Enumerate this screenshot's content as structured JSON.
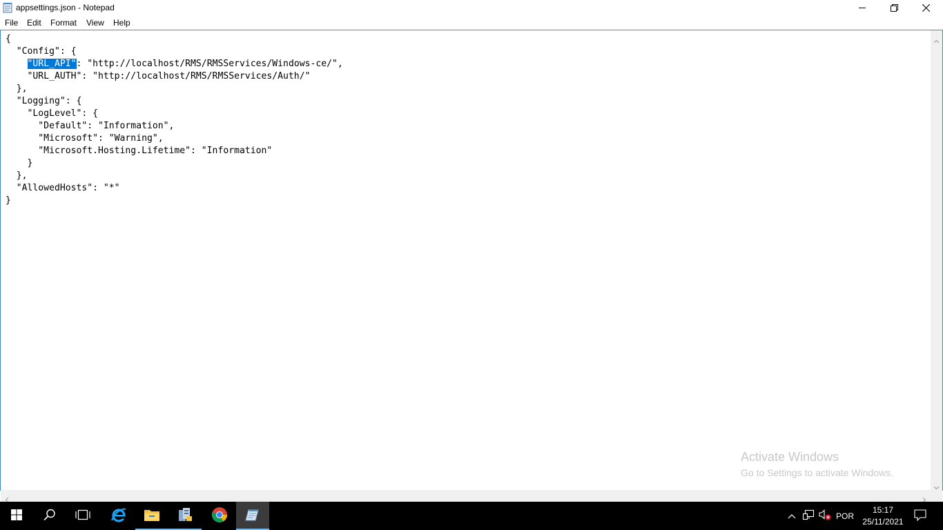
{
  "window": {
    "title": "appsettings.json - Notepad"
  },
  "menu": [
    "File",
    "Edit",
    "Format",
    "View",
    "Help"
  ],
  "editor": {
    "before_selection": "{\n  \"Config\": {\n    ",
    "selected": "\"URL_API\"",
    "after_selection": ": \"http://localhost/RMS/RMSServices/Windows-ce/\",\n    \"URL_AUTH\": \"http://localhost/RMS/RMSServices/Auth/\"\n  },\n  \"Logging\": {\n    \"LogLevel\": {\n      \"Default\": \"Information\",\n      \"Microsoft\": \"Warning\",\n      \"Microsoft.Hosting.Lifetime\": \"Information\"\n    }\n  },\n  \"AllowedHosts\": \"*\"\n}"
  },
  "watermark": {
    "line1": "Activate Windows",
    "line2": "Go to Settings to activate Windows."
  },
  "taskbar": {
    "language": "POR",
    "time": "15:17",
    "date": "25/11/2021"
  },
  "colors": {
    "selection": "#0078d7",
    "editor_border": "#3c8ad4",
    "taskbar": "#000000",
    "active_underline": "#76b9ed"
  },
  "icons": {
    "app": "notepad-icon",
    "minimize": "minimize-icon",
    "maximize": "restore-icon",
    "close": "close-icon"
  }
}
